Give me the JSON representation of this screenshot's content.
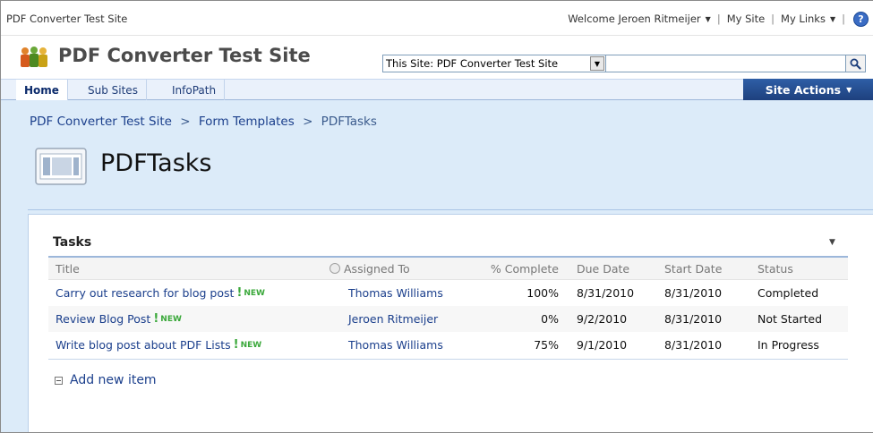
{
  "global": {
    "site_name": "PDF Converter Test Site",
    "welcome": "Welcome Jeroen Ritmeijer",
    "my_site": "My Site",
    "my_links": "My Links",
    "help": "?"
  },
  "header": {
    "title": "PDF Converter Test Site",
    "search_scope": "This Site: PDF Converter Test Site",
    "search_value": ""
  },
  "nav": {
    "tabs": [
      {
        "label": "Home",
        "active": true
      },
      {
        "label": "Sub Sites",
        "active": false
      },
      {
        "label": "InfoPath",
        "active": false
      }
    ],
    "site_actions": "Site Actions"
  },
  "breadcrumb": [
    "PDF Converter Test Site",
    "Form Templates",
    "PDFTasks"
  ],
  "breadcrumb_separator": ">",
  "page": {
    "title": "PDFTasks"
  },
  "webpart": {
    "title": "Tasks",
    "columns": [
      "Title",
      "Assigned To",
      "% Complete",
      "Due Date",
      "Start Date",
      "Status"
    ],
    "rows": [
      {
        "title": "Carry out research for blog post",
        "assigned": "Thomas Williams",
        "pct": "100%",
        "due": "8/31/2010",
        "start": "8/31/2010",
        "status": "Completed"
      },
      {
        "title": "Review Blog Post",
        "assigned": "Jeroen Ritmeijer",
        "pct": "0%",
        "due": "9/2/2010",
        "start": "8/31/2010",
        "status": "Not Started"
      },
      {
        "title": "Write blog post about PDF Lists",
        "assigned": "Thomas Williams",
        "pct": "75%",
        "due": "9/1/2010",
        "start": "8/31/2010",
        "status": "In Progress"
      }
    ],
    "new_mark": "!",
    "new_tag": "NEW",
    "add_new": "Add new item"
  },
  "colors": {
    "accent": "#1d3f7c",
    "body_bg": "#dcebf9",
    "new": "#3aa83a",
    "link": "#1b3f8c"
  }
}
